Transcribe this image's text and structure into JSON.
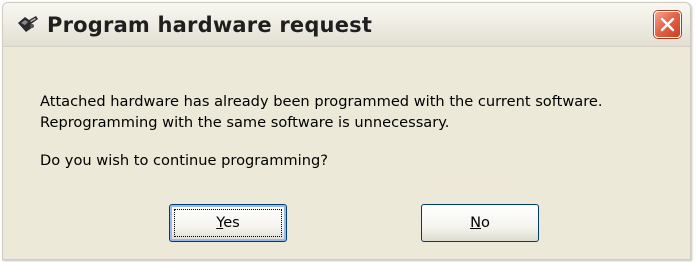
{
  "dialog": {
    "title": "Program hardware request",
    "app_icon": "wrench-flag-icon",
    "close_icon": "close-icon",
    "message": {
      "line1": "Attached hardware has already been programmed with the current software.",
      "line2": "Reprogramming with the same software is unnecessary.",
      "question": "Do you wish to continue programming?"
    },
    "buttons": {
      "yes": {
        "mnemonic": "Y",
        "rest": "es"
      },
      "no": {
        "mnemonic": "N",
        "rest": "o"
      }
    },
    "colors": {
      "dialog_background": "#ece9d8",
      "close_button": "#e3664a",
      "button_border": "#003c74"
    }
  }
}
